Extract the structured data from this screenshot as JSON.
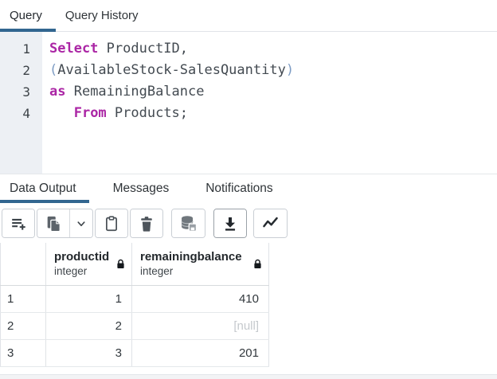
{
  "colors": {
    "accent_underline": "#326690",
    "keyword": "#ab26a5",
    "bracket": "#7d9cc4",
    "gutter_bg": "#edf0f4",
    "null_text": "#c5c9cd",
    "icon": "#3b4248"
  },
  "query_tabs": {
    "items": [
      {
        "label": "Query",
        "active": true
      },
      {
        "label": "Query History",
        "active": false
      }
    ]
  },
  "editor": {
    "lines": [
      {
        "no": "1",
        "tokens": [
          {
            "t": "kw",
            "v": "Select"
          },
          {
            "t": "pl",
            "v": " ProductID,"
          }
        ]
      },
      {
        "no": "2",
        "tokens": [
          {
            "t": "br",
            "v": "("
          },
          {
            "t": "pl",
            "v": "AvailableStock-SalesQuantity"
          },
          {
            "t": "br",
            "v": ")"
          }
        ]
      },
      {
        "no": "3",
        "tokens": [
          {
            "t": "kw",
            "v": "as"
          },
          {
            "t": "pl",
            "v": " RemainingBalance"
          }
        ]
      },
      {
        "no": "4",
        "tokens": [
          {
            "t": "pl",
            "v": "   "
          },
          {
            "t": "kw",
            "v": "From"
          },
          {
            "t": "pl",
            "v": " Products;"
          }
        ]
      }
    ]
  },
  "result_tabs": {
    "active": "Data Output",
    "items": [
      "Data Output",
      "Messages",
      "Notifications"
    ]
  },
  "toolbar": {
    "buttons": [
      {
        "name": "add-row",
        "icon": "add-row-icon"
      },
      {
        "name": "copy",
        "icon": "copy-icon"
      },
      {
        "name": "copy-options",
        "icon": "chevron-down-icon"
      },
      {
        "name": "paste",
        "icon": "paste-icon"
      },
      {
        "name": "delete",
        "icon": "trash-icon"
      },
      {
        "name": "save-data-changes",
        "icon": "database-save-icon"
      },
      {
        "name": "download",
        "icon": "download-icon"
      },
      {
        "name": "graph-visualiser",
        "icon": "line-chart-icon"
      }
    ]
  },
  "grid": {
    "columns": [
      {
        "name": "productid",
        "type": "integer",
        "locked": true
      },
      {
        "name": "remainingbalance",
        "type": "integer",
        "locked": true
      }
    ],
    "rows": [
      {
        "num": "1",
        "cells": [
          "1",
          "410"
        ]
      },
      {
        "num": "2",
        "cells": [
          "2",
          "[null]"
        ]
      },
      {
        "num": "3",
        "cells": [
          "3",
          "201"
        ]
      }
    ]
  }
}
